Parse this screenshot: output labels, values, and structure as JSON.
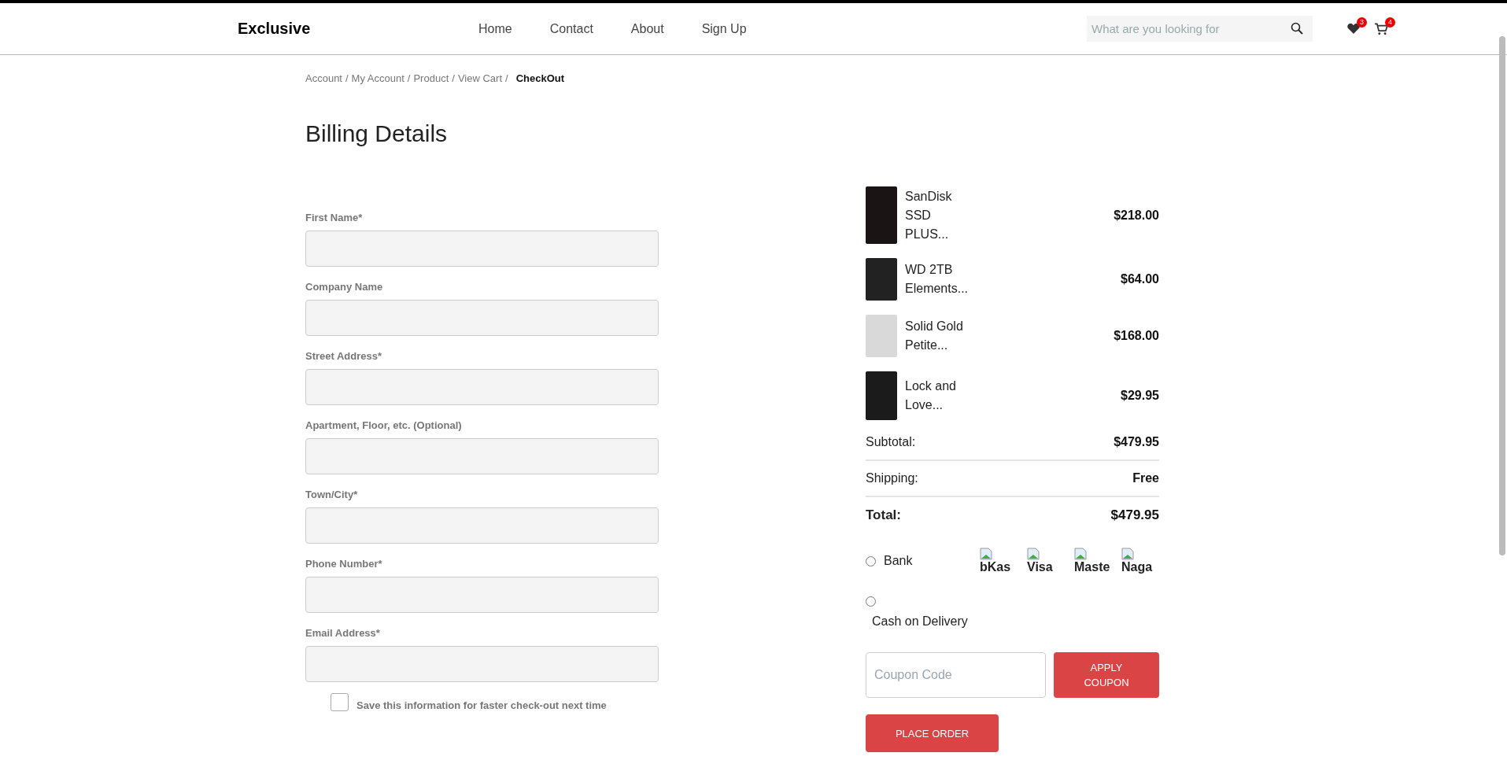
{
  "header": {
    "logo": "Exclusive",
    "nav": [
      {
        "label": "Home"
      },
      {
        "label": "Contact"
      },
      {
        "label": "About"
      },
      {
        "label": "Sign Up"
      }
    ],
    "search": {
      "placeholder": "What are you looking for"
    },
    "wishlist_count": "3",
    "cart_count": "4"
  },
  "breadcrumb": {
    "items": [
      "Account",
      "My Account",
      "Product",
      "View Cart"
    ],
    "separator": "/",
    "current": "CheckOut"
  },
  "title": "Billing Details",
  "form": {
    "fields": [
      {
        "label": "First Name*"
      },
      {
        "label": "Company Name"
      },
      {
        "label": "Street Address*"
      },
      {
        "label": "Apartment, Floor, etc. (Optional)"
      },
      {
        "label": "Town/City*"
      },
      {
        "label": "Phone Number*"
      },
      {
        "label": "Email Address*"
      }
    ],
    "save_info": {
      "label": "Save this information for faster check-out next time",
      "checked": false
    }
  },
  "order": {
    "items": [
      {
        "name": "SanDisk SSD PLUS...",
        "price": "$218.00",
        "kind": "ssd"
      },
      {
        "name": "WD 2TB Elements...",
        "price": "$64.00",
        "kind": "drive"
      },
      {
        "name": "Solid Gold Petite...",
        "price": "$168.00",
        "kind": "ring"
      },
      {
        "name": "Lock and Love...",
        "price": "$29.95",
        "kind": "jacket"
      }
    ],
    "totals": [
      {
        "label": "Subtotal:",
        "value": "$479.95",
        "kind": "line"
      },
      {
        "label": "Shipping:",
        "value": "Free",
        "kind": "line"
      },
      {
        "label": "Total:",
        "value": "$479.95",
        "kind": "total"
      }
    ],
    "payment": [
      {
        "label": "Bank",
        "selected": false,
        "images": [
          "bKas",
          "Visa",
          "Maste",
          "Naga"
        ]
      },
      {
        "label": "Cash on Delivery",
        "selected": false
      }
    ],
    "coupon": {
      "placeholder": "Coupon Code",
      "button": "APPLY COUPON"
    },
    "place_order": "PLACE ORDER"
  }
}
